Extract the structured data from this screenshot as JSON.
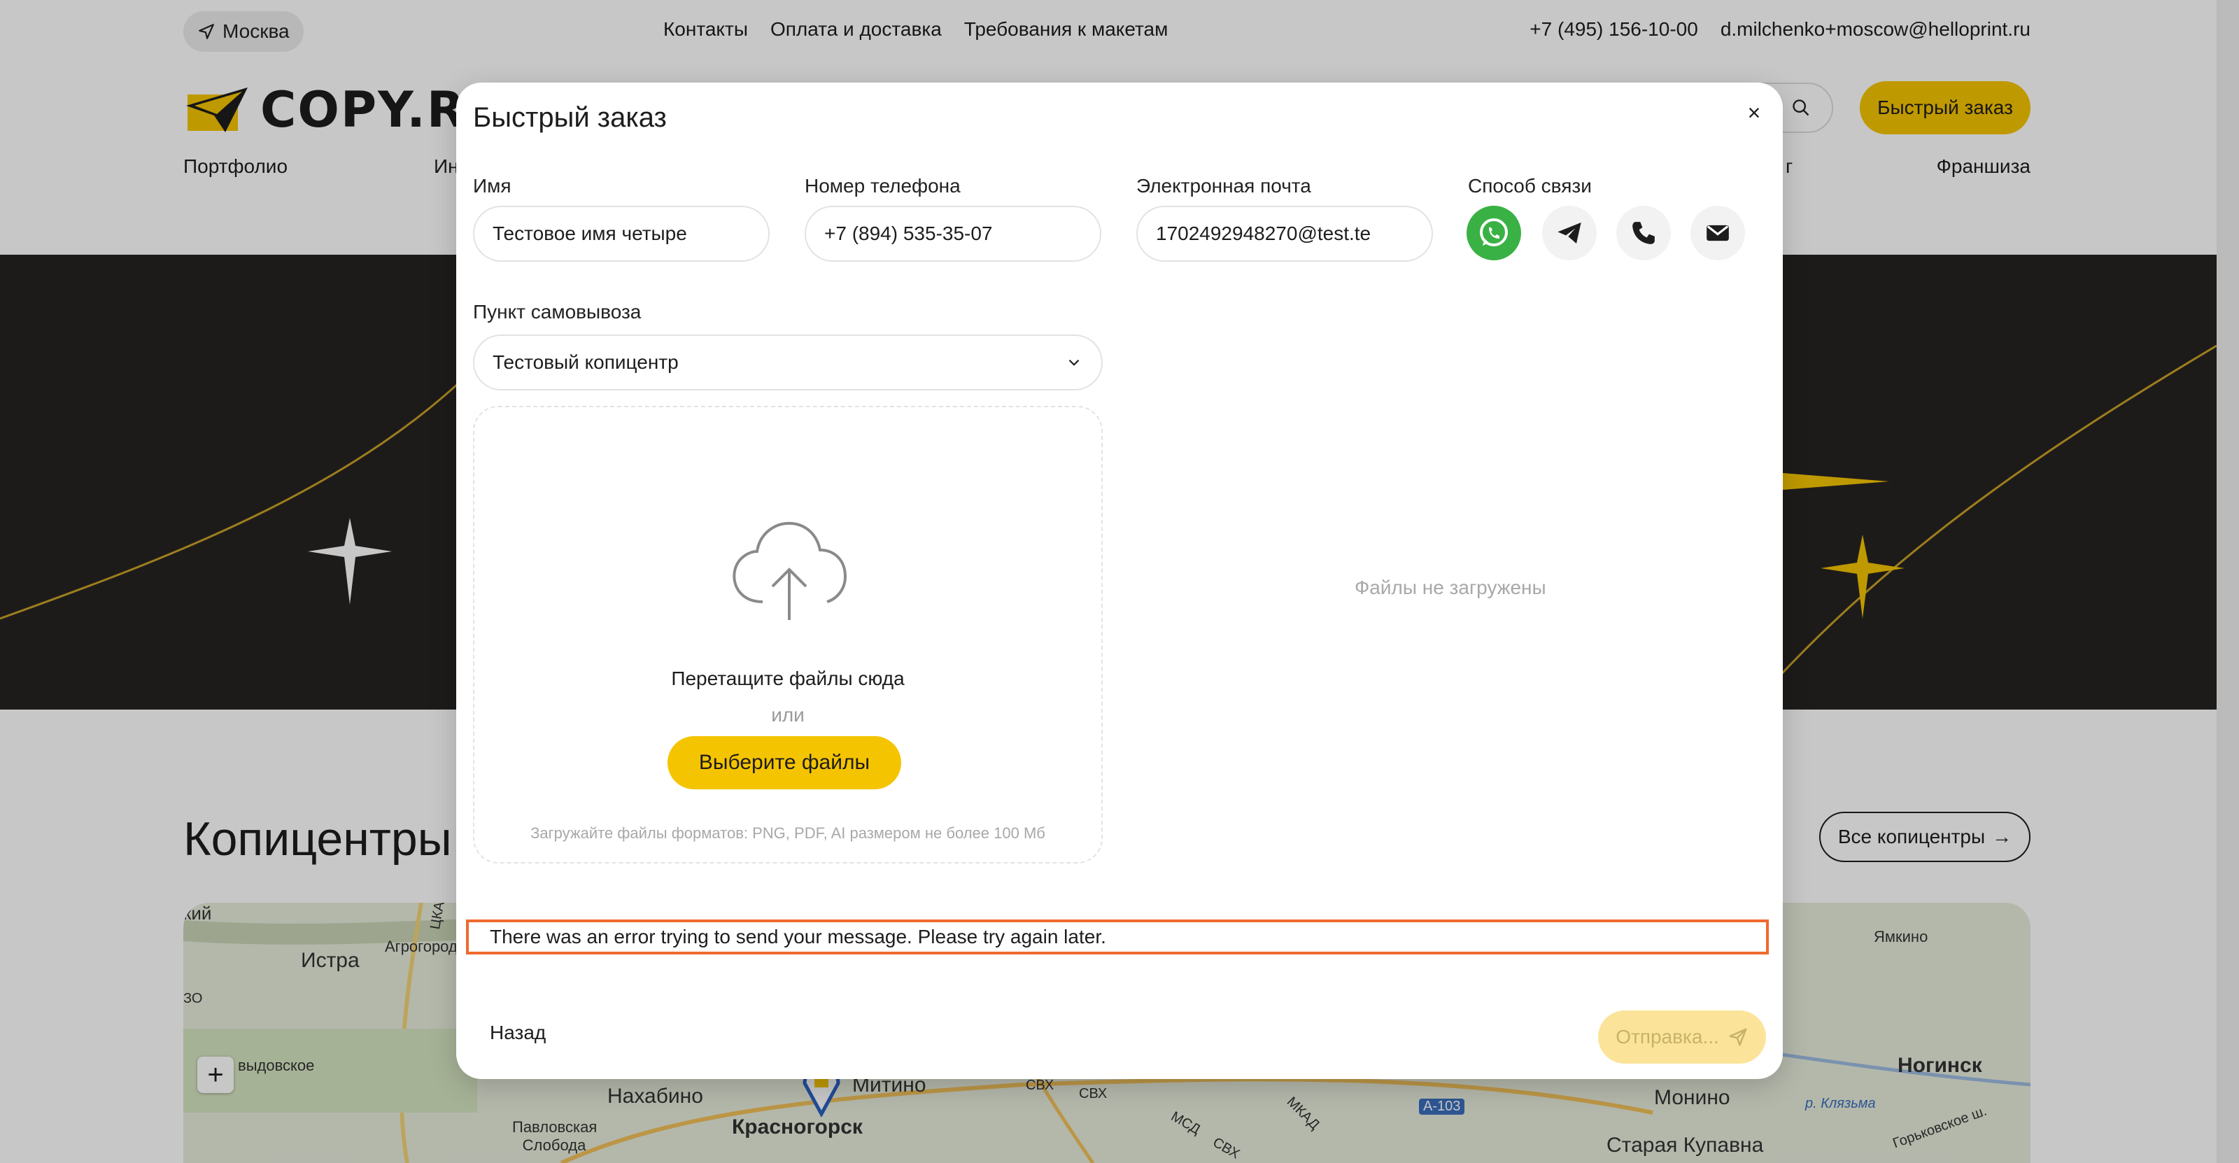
{
  "topbar": {
    "city": "Москва",
    "links": [
      "Контакты",
      "Оплата и доставка",
      "Требования к макетам"
    ],
    "phone": "+7 (495) 156-10-00",
    "email": "d.milchenko+moscow@helloprint.ru"
  },
  "header": {
    "logo_text": "COPY.RU",
    "quick_order_label": "Быстрый заказ"
  },
  "nav": {
    "portfolio": "Портфолио",
    "partial_left": "Ин",
    "partial_right": "г",
    "franchise": "Франшиза"
  },
  "centers": {
    "title": "Копицентры",
    "all_label": "Все копицентры"
  },
  "map": {
    "labels": [
      "кий",
      "Истра",
      "Агрогород",
      "ЦКАД",
      "ЗО",
      "выдовское",
      "Павловская Слобода",
      "Нахабино",
      "Митино",
      "Красногорск",
      "СВХ",
      "СВХ",
      "МСД",
      "СВХ",
      "МКАД",
      "А-103",
      "Ногинск",
      "Монино",
      "Старая Купавна",
      "Ямкино",
      "р. Клязьма",
      "Горьковское ш."
    ]
  },
  "modal": {
    "title": "Быстрый заказ",
    "close": "×",
    "name_label": "Имя",
    "name_value": "Тестовое имя четыре",
    "phone_label": "Номер телефона",
    "phone_value": "+7 (894) 535-35-07",
    "email_label": "Электронная почта",
    "email_value": "1702492948270@test.te",
    "contact_label": "Способ связи",
    "contact_methods": [
      "whatsapp-icon",
      "telegram-icon",
      "phone-icon",
      "mail-icon"
    ],
    "pickup_label": "Пункт самовывоза",
    "pickup_value": "Тестовый копицентр",
    "drop_text": "Перетащите файлы сюда",
    "drop_or": "или",
    "choose_files": "Выберите файлы",
    "drop_hint": "Загружайте файлы форматов: PNG, PDF, AI размером не более 100 Мб",
    "no_files": "Файлы не загружены",
    "error_message": "There was an error trying to send your message. Please try again later.",
    "back_label": "Назад",
    "send_label": "Отправка..."
  },
  "colors": {
    "accent": "#f5c400",
    "error_border": "#ef6b2e",
    "whatsapp": "#3ab144",
    "hero_bg": "#262322"
  }
}
